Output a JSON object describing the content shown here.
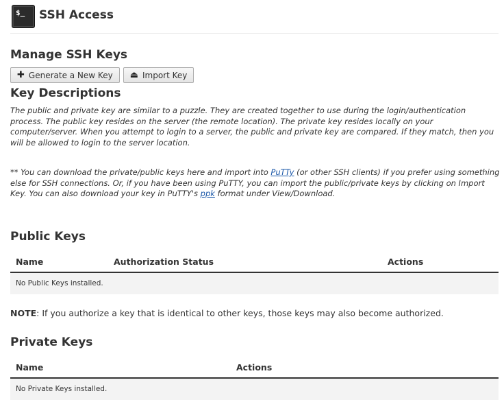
{
  "header": {
    "title": "SSH Access",
    "icon_text": "$_"
  },
  "manage": {
    "heading": "Manage SSH Keys",
    "generate_label": "Generate a New Key",
    "import_label": "Import Key"
  },
  "descriptions": {
    "heading": "Key Descriptions",
    "paragraph1": "The public and private key are similar to a puzzle. They are created together to use during the login/authentication process. The public key resides on the server (the remote location). The private key resides locally on your computer/server. When you attempt to login to a server, the public and private key are compared. If they match, then you will be allowed to login to the server location.",
    "p2_before": "** You can download the private/public keys here and import into ",
    "p2_link1": "PuTTy",
    "p2_middle": " (or other SSH clients) if you prefer using something else for SSH connections. Or, if you have been using PuTTY, you can import the public/private keys by clicking on Import Key. You can also download your key in PuTTY's ",
    "p2_link2": "ppk",
    "p2_after": " format under View/Download."
  },
  "public_keys": {
    "heading": "Public Keys",
    "columns": [
      "Name",
      "Authorization Status",
      "Actions"
    ],
    "empty_text": "No Public Keys installed."
  },
  "note": {
    "label": "NOTE",
    "text": ": If you authorize a key that is identical to other keys, those keys may also become authorized."
  },
  "private_keys": {
    "heading": "Private Keys",
    "columns": [
      "Name",
      "Actions"
    ],
    "empty_text": "No Private Keys installed."
  }
}
